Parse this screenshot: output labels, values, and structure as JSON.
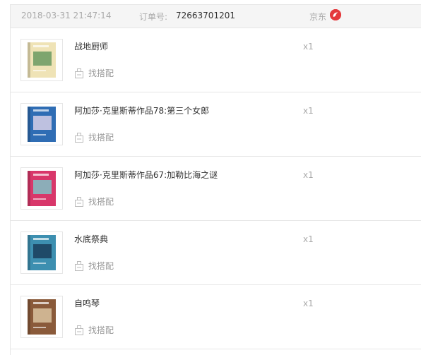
{
  "order": {
    "date": "2018-03-31 21:47:14",
    "order_label": "订单号:",
    "order_number": "72663701201",
    "shop": "京东",
    "shop_logo_icon": "jd-shop-logo-icon",
    "accent": "#e4393c"
  },
  "items": [
    {
      "title": "战地厨师",
      "qty": "x1",
      "match_label": "找搭配",
      "cover": {
        "bg": "#efe3b6",
        "accent": "#6a9a62"
      }
    },
    {
      "title": "阿加莎·克里斯蒂作品78:第三个女郎",
      "qty": "x1",
      "match_label": "找搭配",
      "cover": {
        "bg": "#2f6db4",
        "accent": "#d7d0e8"
      }
    },
    {
      "title": "阿加莎·克里斯蒂作品67:加勒比海之谜",
      "qty": "x1",
      "match_label": "找搭配",
      "cover": {
        "bg": "#d8376a",
        "accent": "#7fc2c6"
      }
    },
    {
      "title": "水底祭典",
      "qty": "x1",
      "match_label": "找搭配",
      "cover": {
        "bg": "#3d8fb0",
        "accent": "#1a3e5c"
      }
    },
    {
      "title": "自鸣琴",
      "qty": "x1",
      "match_label": "找搭配",
      "cover": {
        "bg": "#8a5a3a",
        "accent": "#d9c3a0"
      }
    }
  ]
}
